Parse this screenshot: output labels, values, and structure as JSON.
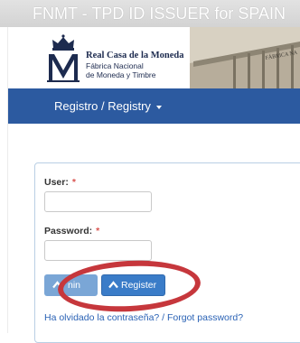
{
  "window": {
    "title": "FNMT - TPD ID ISSUER for SPAIN"
  },
  "brand": {
    "name": "Real Casa de la Moneda",
    "subtitle_line1": "Fábrica Nacional",
    "subtitle_line2": "de Moneda y Timbre",
    "logo_icon": "crowned-m-logo-icon",
    "building_sign": "FÁBRICA NA"
  },
  "nav": {
    "menu_label": "Registro / Registry",
    "menu_icon": "caret-down-icon"
  },
  "form": {
    "user_label": "User:",
    "password_label": "Password:",
    "required_mark": "*",
    "user_value": "",
    "password_value": "",
    "login_label": "nin",
    "register_label": "Register",
    "button_icon": "chevron-up-icon",
    "forgot_link": "Ha olvidado la contraseña? / Forgot password?"
  },
  "colors": {
    "navbar": "#2c5aa0",
    "brand_text": "#1d2b4f",
    "button_primary": "#3a7cc8",
    "button_login": "#7aa6d6",
    "link": "#2a62b5",
    "required": "#d9534f",
    "annotation": "#c6373c"
  }
}
